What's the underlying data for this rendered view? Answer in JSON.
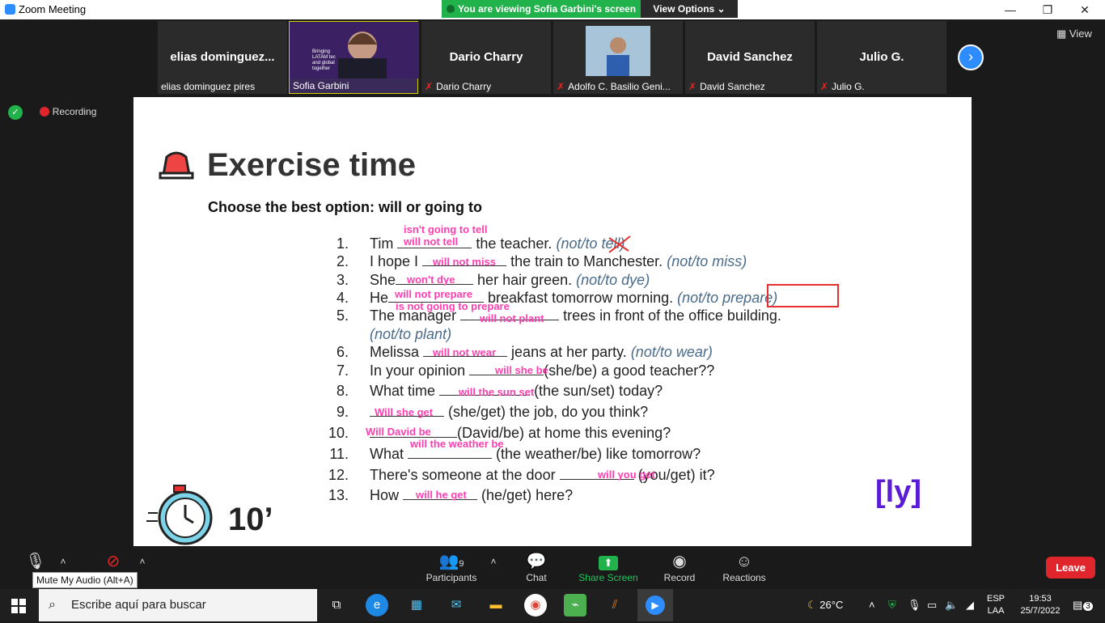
{
  "window": {
    "title": "Zoom Meeting",
    "minimize": "—",
    "restore": "❐",
    "close": "✕"
  },
  "share_banner": {
    "text": "You are viewing Sofia Garbini's screen",
    "view_options": "View Options ⌄"
  },
  "participants": [
    {
      "big": "elias  dominguez...",
      "label": "elias dominguez pires",
      "muted": false
    },
    {
      "big": "",
      "label": "Sofia Garbini",
      "muted": false,
      "active": true
    },
    {
      "big": "Dario Charry",
      "label": "Dario Charry",
      "muted": true
    },
    {
      "big": "",
      "label": "Adolfo C. Basilio Geni...",
      "muted": true
    },
    {
      "big": "David Sanchez",
      "label": "David Sanchez",
      "muted": true
    },
    {
      "big": "Julio G.",
      "label": "Julio G.",
      "muted": true
    }
  ],
  "sofia_slide_text": "Bringing LATAM tec and global together",
  "view_button": "View",
  "recording": "Recording",
  "slide": {
    "title": "Exercise time",
    "subtitle": "Choose the best option: will or going to",
    "exercises": [
      {
        "n": "1.",
        "pre": "Tim",
        "post": "the teacher.",
        "hint": "(not/to tell)"
      },
      {
        "n": "2.",
        "pre": "I hope I",
        "post": "the train to Manchester.",
        "hint": "(not/to miss)"
      },
      {
        "n": "3.",
        "pre": "She",
        "post": "her hair green.",
        "hint": "(not/to dye)"
      },
      {
        "n": "4.",
        "pre": "He",
        "post": "breakfast tomorrow morning.",
        "hint": "(not/to prepare)"
      },
      {
        "n": "5.",
        "pre": "The manager",
        "post": "trees in front of the office building.",
        "hint": ""
      },
      {
        "n": "",
        "pre": "",
        "post": "",
        "hint": "(not/to plant)"
      },
      {
        "n": "6.",
        "pre": "Melissa",
        "post": "jeans at her party.",
        "hint": "(not/to wear)"
      },
      {
        "n": "7.",
        "pre": "In your opinion",
        "post": "(she/be) a good teacher??",
        "hint": ""
      },
      {
        "n": "8.",
        "pre": "What time",
        "post": "(the sun/set) today?",
        "hint": ""
      },
      {
        "n": "9.",
        "pre": "",
        "post": "(she/get) the job, do you think?",
        "hint": ""
      },
      {
        "n": "10.",
        "pre": "",
        "post": "(David/be) at home this evening?",
        "hint": ""
      },
      {
        "n": "11.",
        "pre": "What",
        "post": "(the weather/be) like tomorrow?",
        "hint": ""
      },
      {
        "n": "12.",
        "pre": "There's someone at the door",
        "post": "(you/get) it?",
        "hint": ""
      },
      {
        "n": "13.",
        "pre": "How",
        "post": "(he/get) here?",
        "hint": ""
      }
    ],
    "answers": [
      "isn't going to tell",
      "will not tell",
      "will not miss",
      "won't dye",
      "will not prepare",
      "is not going to prepare",
      "will not plant",
      "will not wear",
      "will she be",
      "will the sun set",
      "Will she get",
      "Will David be",
      "will the weather be",
      "will you get",
      "will he get"
    ],
    "timer": "10’",
    "logo": "[ly]"
  },
  "toolbar": {
    "mute_tooltip": "Mute My Audio (Alt+A)",
    "participants_count": "9",
    "participants": "Participants",
    "chat": "Chat",
    "share": "Share Screen",
    "record": "Record",
    "reactions": "Reactions",
    "leave": "Leave"
  },
  "taskbar": {
    "search_placeholder": "Escribe aquí para buscar",
    "temp": "26°C",
    "lang1": "ESP",
    "lang2": "LAA",
    "time": "19:53",
    "date": "25/7/2022",
    "notif": "3"
  },
  "colors": {
    "accent": "#2d8cff",
    "share_green": "#22b24c",
    "answer_pink": "#ff3fb0",
    "leave_red": "#e0252c"
  }
}
